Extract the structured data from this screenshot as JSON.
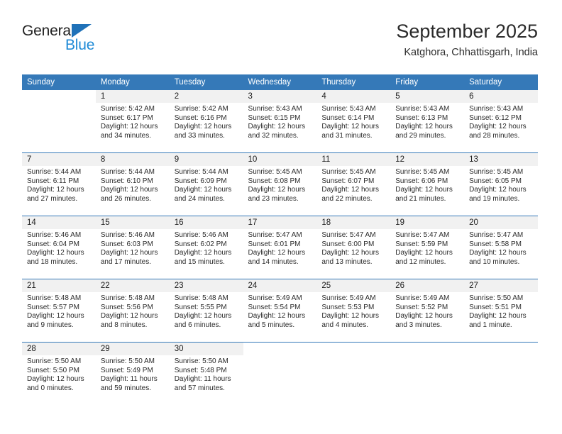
{
  "brand": {
    "word_one": "General",
    "word_two": "Blue",
    "triangle_icon": "brand-triangle-icon"
  },
  "header": {
    "title": "September 2025",
    "subtitle": "Katghora, Chhattisgarh, India"
  },
  "theme": {
    "header_blue": "#3579b8",
    "brand_dark_blue": "#1f71b8",
    "brand_light_blue": "#1f8ad6",
    "daynum_band": "#f1f1f1",
    "text": "#2a2a2a"
  },
  "weekday_headers": [
    "Sunday",
    "Monday",
    "Tuesday",
    "Wednesday",
    "Thursday",
    "Friday",
    "Saturday"
  ],
  "labels": {
    "sunrise_prefix": "Sunrise:",
    "sunset_prefix": "Sunset:",
    "daylight_prefix": "Daylight:"
  },
  "weeks": [
    [
      {
        "day": "",
        "sunrise": "",
        "sunset": "",
        "daylight_line1": "",
        "daylight_line2": ""
      },
      {
        "day": "1",
        "sunrise": "Sunrise: 5:42 AM",
        "sunset": "Sunset: 6:17 PM",
        "daylight_line1": "Daylight: 12 hours",
        "daylight_line2": "and 34 minutes."
      },
      {
        "day": "2",
        "sunrise": "Sunrise: 5:42 AM",
        "sunset": "Sunset: 6:16 PM",
        "daylight_line1": "Daylight: 12 hours",
        "daylight_line2": "and 33 minutes."
      },
      {
        "day": "3",
        "sunrise": "Sunrise: 5:43 AM",
        "sunset": "Sunset: 6:15 PM",
        "daylight_line1": "Daylight: 12 hours",
        "daylight_line2": "and 32 minutes."
      },
      {
        "day": "4",
        "sunrise": "Sunrise: 5:43 AM",
        "sunset": "Sunset: 6:14 PM",
        "daylight_line1": "Daylight: 12 hours",
        "daylight_line2": "and 31 minutes."
      },
      {
        "day": "5",
        "sunrise": "Sunrise: 5:43 AM",
        "sunset": "Sunset: 6:13 PM",
        "daylight_line1": "Daylight: 12 hours",
        "daylight_line2": "and 29 minutes."
      },
      {
        "day": "6",
        "sunrise": "Sunrise: 5:43 AM",
        "sunset": "Sunset: 6:12 PM",
        "daylight_line1": "Daylight: 12 hours",
        "daylight_line2": "and 28 minutes."
      }
    ],
    [
      {
        "day": "7",
        "sunrise": "Sunrise: 5:44 AM",
        "sunset": "Sunset: 6:11 PM",
        "daylight_line1": "Daylight: 12 hours",
        "daylight_line2": "and 27 minutes."
      },
      {
        "day": "8",
        "sunrise": "Sunrise: 5:44 AM",
        "sunset": "Sunset: 6:10 PM",
        "daylight_line1": "Daylight: 12 hours",
        "daylight_line2": "and 26 minutes."
      },
      {
        "day": "9",
        "sunrise": "Sunrise: 5:44 AM",
        "sunset": "Sunset: 6:09 PM",
        "daylight_line1": "Daylight: 12 hours",
        "daylight_line2": "and 24 minutes."
      },
      {
        "day": "10",
        "sunrise": "Sunrise: 5:45 AM",
        "sunset": "Sunset: 6:08 PM",
        "daylight_line1": "Daylight: 12 hours",
        "daylight_line2": "and 23 minutes."
      },
      {
        "day": "11",
        "sunrise": "Sunrise: 5:45 AM",
        "sunset": "Sunset: 6:07 PM",
        "daylight_line1": "Daylight: 12 hours",
        "daylight_line2": "and 22 minutes."
      },
      {
        "day": "12",
        "sunrise": "Sunrise: 5:45 AM",
        "sunset": "Sunset: 6:06 PM",
        "daylight_line1": "Daylight: 12 hours",
        "daylight_line2": "and 21 minutes."
      },
      {
        "day": "13",
        "sunrise": "Sunrise: 5:45 AM",
        "sunset": "Sunset: 6:05 PM",
        "daylight_line1": "Daylight: 12 hours",
        "daylight_line2": "and 19 minutes."
      }
    ],
    [
      {
        "day": "14",
        "sunrise": "Sunrise: 5:46 AM",
        "sunset": "Sunset: 6:04 PM",
        "daylight_line1": "Daylight: 12 hours",
        "daylight_line2": "and 18 minutes."
      },
      {
        "day": "15",
        "sunrise": "Sunrise: 5:46 AM",
        "sunset": "Sunset: 6:03 PM",
        "daylight_line1": "Daylight: 12 hours",
        "daylight_line2": "and 17 minutes."
      },
      {
        "day": "16",
        "sunrise": "Sunrise: 5:46 AM",
        "sunset": "Sunset: 6:02 PM",
        "daylight_line1": "Daylight: 12 hours",
        "daylight_line2": "and 15 minutes."
      },
      {
        "day": "17",
        "sunrise": "Sunrise: 5:47 AM",
        "sunset": "Sunset: 6:01 PM",
        "daylight_line1": "Daylight: 12 hours",
        "daylight_line2": "and 14 minutes."
      },
      {
        "day": "18",
        "sunrise": "Sunrise: 5:47 AM",
        "sunset": "Sunset: 6:00 PM",
        "daylight_line1": "Daylight: 12 hours",
        "daylight_line2": "and 13 minutes."
      },
      {
        "day": "19",
        "sunrise": "Sunrise: 5:47 AM",
        "sunset": "Sunset: 5:59 PM",
        "daylight_line1": "Daylight: 12 hours",
        "daylight_line2": "and 12 minutes."
      },
      {
        "day": "20",
        "sunrise": "Sunrise: 5:47 AM",
        "sunset": "Sunset: 5:58 PM",
        "daylight_line1": "Daylight: 12 hours",
        "daylight_line2": "and 10 minutes."
      }
    ],
    [
      {
        "day": "21",
        "sunrise": "Sunrise: 5:48 AM",
        "sunset": "Sunset: 5:57 PM",
        "daylight_line1": "Daylight: 12 hours",
        "daylight_line2": "and 9 minutes."
      },
      {
        "day": "22",
        "sunrise": "Sunrise: 5:48 AM",
        "sunset": "Sunset: 5:56 PM",
        "daylight_line1": "Daylight: 12 hours",
        "daylight_line2": "and 8 minutes."
      },
      {
        "day": "23",
        "sunrise": "Sunrise: 5:48 AM",
        "sunset": "Sunset: 5:55 PM",
        "daylight_line1": "Daylight: 12 hours",
        "daylight_line2": "and 6 minutes."
      },
      {
        "day": "24",
        "sunrise": "Sunrise: 5:49 AM",
        "sunset": "Sunset: 5:54 PM",
        "daylight_line1": "Daylight: 12 hours",
        "daylight_line2": "and 5 minutes."
      },
      {
        "day": "25",
        "sunrise": "Sunrise: 5:49 AM",
        "sunset": "Sunset: 5:53 PM",
        "daylight_line1": "Daylight: 12 hours",
        "daylight_line2": "and 4 minutes."
      },
      {
        "day": "26",
        "sunrise": "Sunrise: 5:49 AM",
        "sunset": "Sunset: 5:52 PM",
        "daylight_line1": "Daylight: 12 hours",
        "daylight_line2": "and 3 minutes."
      },
      {
        "day": "27",
        "sunrise": "Sunrise: 5:50 AM",
        "sunset": "Sunset: 5:51 PM",
        "daylight_line1": "Daylight: 12 hours",
        "daylight_line2": "and 1 minute."
      }
    ],
    [
      {
        "day": "28",
        "sunrise": "Sunrise: 5:50 AM",
        "sunset": "Sunset: 5:50 PM",
        "daylight_line1": "Daylight: 12 hours",
        "daylight_line2": "and 0 minutes."
      },
      {
        "day": "29",
        "sunrise": "Sunrise: 5:50 AM",
        "sunset": "Sunset: 5:49 PM",
        "daylight_line1": "Daylight: 11 hours",
        "daylight_line2": "and 59 minutes."
      },
      {
        "day": "30",
        "sunrise": "Sunrise: 5:50 AM",
        "sunset": "Sunset: 5:48 PM",
        "daylight_line1": "Daylight: 11 hours",
        "daylight_line2": "and 57 minutes."
      },
      {
        "day": "",
        "sunrise": "",
        "sunset": "",
        "daylight_line1": "",
        "daylight_line2": ""
      },
      {
        "day": "",
        "sunrise": "",
        "sunset": "",
        "daylight_line1": "",
        "daylight_line2": ""
      },
      {
        "day": "",
        "sunrise": "",
        "sunset": "",
        "daylight_line1": "",
        "daylight_line2": ""
      },
      {
        "day": "",
        "sunrise": "",
        "sunset": "",
        "daylight_line1": "",
        "daylight_line2": ""
      }
    ]
  ]
}
